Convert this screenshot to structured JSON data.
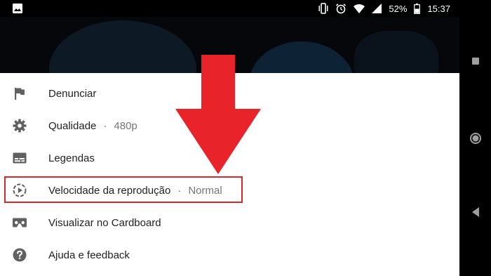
{
  "status_bar": {
    "battery": "52%",
    "time": "15:37",
    "icons": [
      "image-icon",
      "vibrate-icon",
      "alarm-icon",
      "wifi-icon",
      "signal-icon",
      "battery-icon"
    ]
  },
  "menu": {
    "items": [
      {
        "label": "Denunciar",
        "icon": "flag-icon"
      },
      {
        "label": "Qualidade",
        "value": "480p",
        "icon": "gear-icon"
      },
      {
        "label": "Legendas",
        "icon": "captions-icon"
      },
      {
        "label": "Velocidade da reprodução",
        "value": "Normal",
        "icon": "playback-speed-icon"
      },
      {
        "label": "Visualizar no Cardboard",
        "icon": "cardboard-icon"
      },
      {
        "label": "Ajuda e feedback",
        "icon": "help-icon"
      }
    ],
    "separator": "·"
  },
  "colors": {
    "accent_red": "#e8232a",
    "highlight_border": "#d8262b",
    "icon_gray": "#616161",
    "text": "#212121",
    "secondary_text": "#757575"
  }
}
